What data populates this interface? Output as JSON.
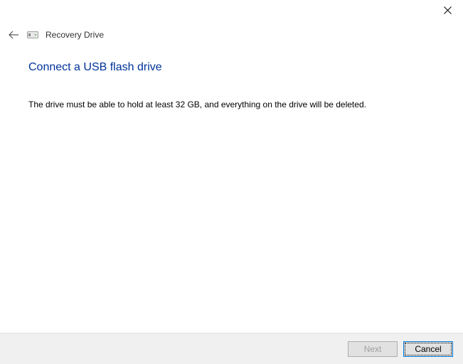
{
  "window": {
    "title": "Recovery Drive"
  },
  "page": {
    "heading": "Connect a USB flash drive",
    "description": "The drive must be able to hold at least 32 GB, and everything on the drive will be deleted."
  },
  "buttons": {
    "next": "Next",
    "cancel": "Cancel"
  }
}
